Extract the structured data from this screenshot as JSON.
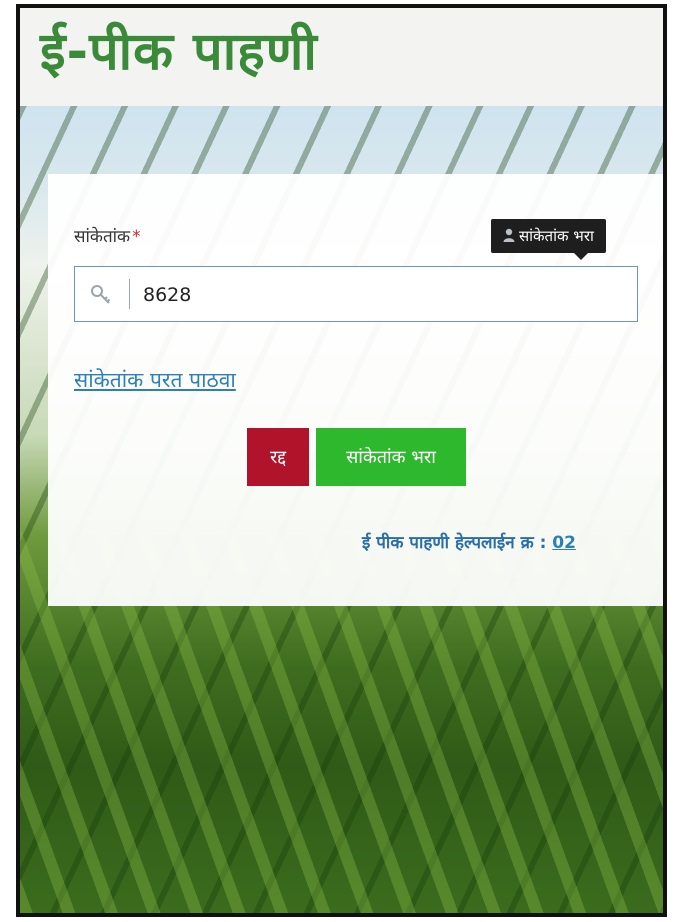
{
  "header": {
    "title": "ई-पीक पाहणी"
  },
  "form": {
    "code_label": "सांकेतांक",
    "required_mark": "*",
    "tooltip_text": "सांकेतांक भरा",
    "code_value": "8628",
    "resend_link": "सांकेतांक परत पाठवा",
    "cancel_label": "रद्द",
    "submit_label": "सांकेतांक भरा",
    "helpline_text": "ई पीक पाहणी हेल्पलाईन क्र : ",
    "helpline_number": "02"
  },
  "colors": {
    "title_green": "#3a8a3a",
    "cancel_red": "#b0132a",
    "submit_green": "#2eb82e",
    "link_blue": "#2d7fb8"
  },
  "icons": {
    "tooltip": "user-icon",
    "input": "key-icon"
  }
}
